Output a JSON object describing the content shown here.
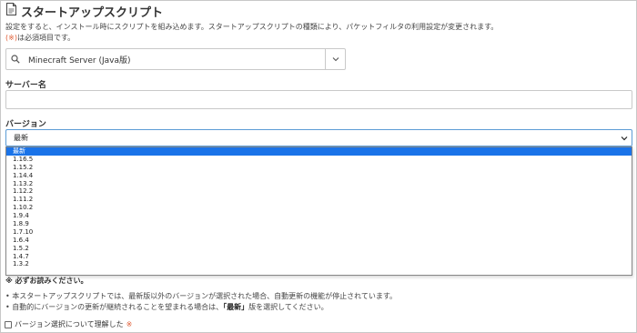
{
  "header": {
    "title": "スタートアップスクリプト",
    "desc_line1": "設定をすると、インストール時にスクリプトを組み込めます。スタートアップスクリプトの種類により、パケットフィルタの利用設定が変更されます。",
    "required_mark": "(※)",
    "desc_line2_rest": "は必須項目です。"
  },
  "script_select": {
    "value": "Minecraft Server (Java版)"
  },
  "server_name": {
    "label": "サーバー名",
    "value": ""
  },
  "version": {
    "label": "バージョン",
    "selected": "最新",
    "options": [
      "最新",
      "1.16.5",
      "1.15.2",
      "1.14.4",
      "1.13.2",
      "1.12.2",
      "1.11.2",
      "1.10.2",
      "1.9.4",
      "1.8.9",
      "1.7.10",
      "1.6.4",
      "1.5.2",
      "1.4.7",
      "1.3.2"
    ]
  },
  "notice": {
    "title": "※ 必ずお読みください。",
    "bullet1": "本スタートアップスクリプトでは、最新版以外のバージョンが選択された場合、自動更新の機能が停止されています。",
    "bullet2_pre": "自動的にバージョンの更新が継続されることを望まれる場合は、",
    "bullet2_bold": "「最新」",
    "bullet2_post": "版を選択してください。"
  },
  "confirm": {
    "label": "バージョン選択について理解した",
    "required": "※"
  },
  "colors": {
    "accent": "#1a73e8",
    "required": "#e05a32",
    "focus_border": "#5b9bd5"
  },
  "icons": {
    "title": "document-icon",
    "search": "search-icon",
    "chevron": "chevron-down-icon"
  }
}
